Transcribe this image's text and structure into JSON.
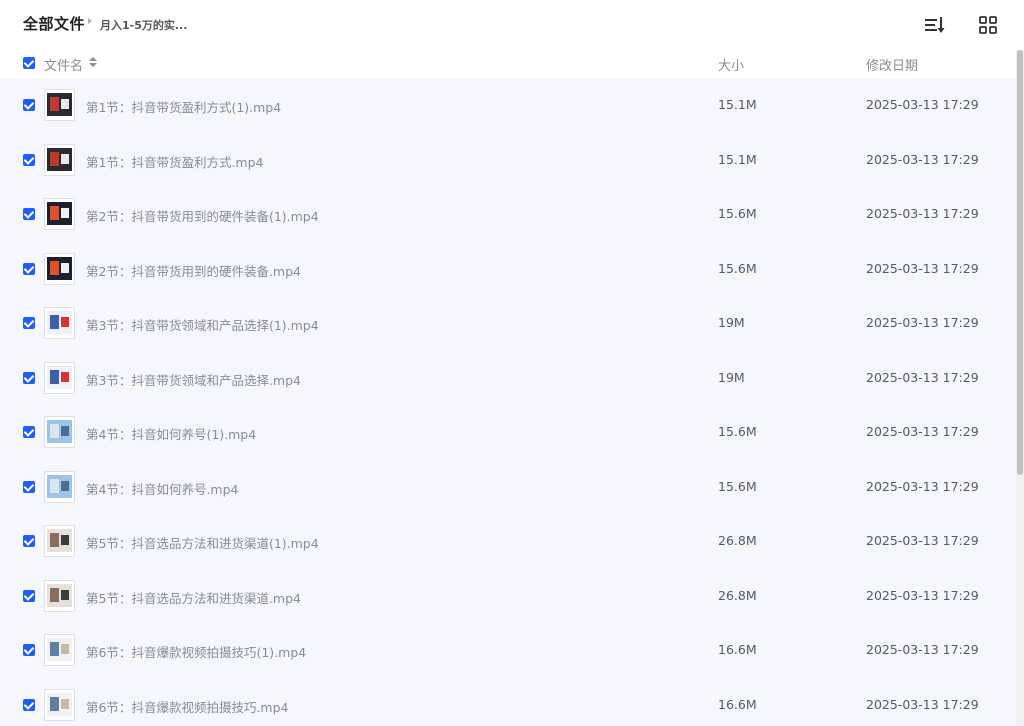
{
  "breadcrumb": {
    "root": "全部文件",
    "current": "月入1-5万的实..."
  },
  "toolbar": {
    "sort_icon": "sort-list-icon",
    "view_icon": "grid-view-icon"
  },
  "columns": {
    "name": "文件名",
    "size": "大小",
    "date": "修改日期"
  },
  "colors": {
    "accent": "#1e5eff",
    "row_selected_bg": "#f5f7fc",
    "muted_text": "#878c96"
  },
  "files": [
    {
      "name": "第1节：抖音带货盈利方式(1).mp4",
      "size": "15.1M",
      "date": "2025-03-13 17:29",
      "selected": true,
      "thumb": "dark-red"
    },
    {
      "name": "第1节：抖音带货盈利方式.mp4",
      "size": "15.1M",
      "date": "2025-03-13 17:29",
      "selected": true,
      "thumb": "dark-red"
    },
    {
      "name": "第2节：抖音带货用到的硬件装备(1).mp4",
      "size": "15.6M",
      "date": "2025-03-13 17:29",
      "selected": true,
      "thumb": "dark-orange"
    },
    {
      "name": "第2节：抖音带货用到的硬件装备.mp4",
      "size": "15.6M",
      "date": "2025-03-13 17:29",
      "selected": true,
      "thumb": "dark-orange"
    },
    {
      "name": "第3节：抖音带货领域和产品选择(1).mp4",
      "size": "19M",
      "date": "2025-03-13 17:29",
      "selected": true,
      "thumb": "light-blue"
    },
    {
      "name": "第3节：抖音带货领域和产品选择.mp4",
      "size": "19M",
      "date": "2025-03-13 17:29",
      "selected": true,
      "thumb": "light-blue"
    },
    {
      "name": "第4节：抖音如何养号(1).mp4",
      "size": "15.6M",
      "date": "2025-03-13 17:29",
      "selected": true,
      "thumb": "sky"
    },
    {
      "name": "第4节：抖音如何养号.mp4",
      "size": "15.6M",
      "date": "2025-03-13 17:29",
      "selected": true,
      "thumb": "sky"
    },
    {
      "name": "第5节：抖音选品方法和进货渠道(1).mp4",
      "size": "26.8M",
      "date": "2025-03-13 17:29",
      "selected": true,
      "thumb": "person"
    },
    {
      "name": "第5节：抖音选品方法和进货渠道.mp4",
      "size": "26.8M",
      "date": "2025-03-13 17:29",
      "selected": true,
      "thumb": "person"
    },
    {
      "name": "第6节：抖音爆款视频拍摄技巧(1).mp4",
      "size": "16.6M",
      "date": "2025-03-13 17:29",
      "selected": true,
      "thumb": "person-blue"
    },
    {
      "name": "第6节：抖音爆款视频拍摄技巧.mp4",
      "size": "16.6M",
      "date": "2025-03-13 17:29",
      "selected": true,
      "thumb": "person-blue"
    }
  ]
}
